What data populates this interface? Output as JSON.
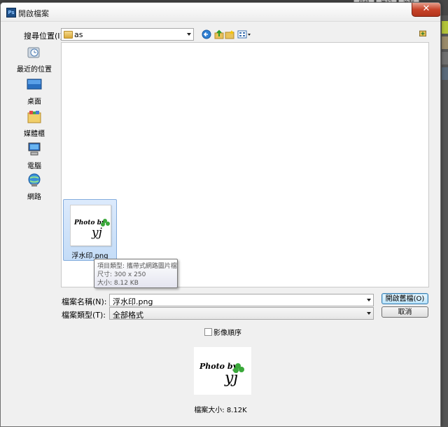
{
  "window": {
    "title": "開啟檔案",
    "close_symbol": "✕"
  },
  "background": {
    "tabs": [
      "目錄",
      "筆記",
      "複製"
    ]
  },
  "toolbar": {
    "search_location_label": "搜尋位置(I):",
    "current_folder": "as"
  },
  "places": [
    {
      "label": "最近的位置",
      "icon": "recent-places-icon"
    },
    {
      "label": "桌面",
      "icon": "desktop-icon"
    },
    {
      "label": "媒體櫃",
      "icon": "libraries-icon"
    },
    {
      "label": "電腦",
      "icon": "computer-icon"
    },
    {
      "label": "網路",
      "icon": "network-icon"
    }
  ],
  "files": [
    {
      "name": "浮水印.png",
      "selected": true
    }
  ],
  "tooltip": {
    "type": "項目類型: 攜帶式網路圖片檔",
    "dimensions": "尺寸: 300 x 250",
    "size": "大小: 8.12 KB"
  },
  "form": {
    "filename_label": "檔案名稱(N):",
    "filename_value": "浮水印.png",
    "filetype_label": "檔案類型(T):",
    "filetype_value": "全部格式",
    "open_button": "開啟舊檔(O)",
    "cancel_button": "取消",
    "image_sequence_label": "影像順序",
    "image_sequence_checked": false
  },
  "preview": {
    "file_size_text": "檔案大小: 8.12K"
  },
  "watermark": {
    "text1": "Photo by",
    "text2": "yj"
  }
}
